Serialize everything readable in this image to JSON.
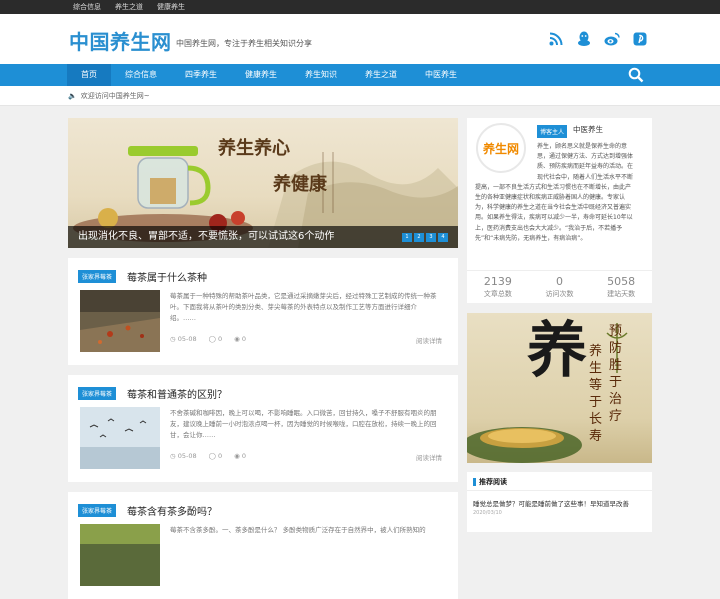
{
  "topbar": {
    "links": [
      "综合信息",
      "养生之道",
      "健康养生"
    ]
  },
  "header": {
    "logo": "中国养生网",
    "slogan": "中国养生网，专注于养生相关知识分享"
  },
  "social_icons": [
    "rss-icon",
    "qq-icon",
    "weibo-icon",
    "pinterest-icon"
  ],
  "nav": {
    "items": [
      "首页",
      "综合信息",
      "四季养生",
      "健康养生",
      "养生知识",
      "养生之道",
      "中医养生"
    ]
  },
  "notice": "欢迎访问中国养生网~",
  "slider": {
    "caption": "出现消化不良、胃部不适，不要慌张，可以试试这6个动作",
    "calligraphy_top": "养生养心",
    "calligraphy_bottom": "养健康",
    "dots": [
      "1",
      "2",
      "3",
      "4"
    ]
  },
  "posts": [
    {
      "tag": "张家界莓茶",
      "title": "莓茶属于什么茶种",
      "excerpt": "莓茶属于一种特殊的帮助茶叶品类，它是通过采摘嫩芽尖后，经过特殊工艺制成的传统一种茶叶。下面我将从茶叶的类别分类、芽尖莓茶的外表特点以及制作工艺等方面进行详细介绍。……",
      "date": "05-08",
      "comments": "0",
      "likes": "0",
      "more": "阅读详情"
    },
    {
      "tag": "张家界莓茶",
      "title": "莓茶和普通茶的区别？",
      "excerpt": "不舍茶碱和咖啡因，晚上可以喝，不影响睡眠。入口微苦，回甘持久，嗓子不舒服有咽炎的朋友，建议晚上睡前一小时泡浓点喝一杯，因为睡觉的时候喉咙，口腔在放松，持续一晚上的回甘，会让你……",
      "date": "05-08",
      "comments": "0",
      "likes": "0",
      "more": "阅读详情"
    },
    {
      "tag": "张家界莓茶",
      "title": "莓茶含有茶多酚吗？",
      "excerpt": "莓茶不含茶多酚。一、茶多酚是什么？ 多酚类物质广泛存在于自然界中，被人们所熟知的",
      "date": "",
      "comments": "",
      "likes": "",
      "more": ""
    }
  ],
  "profile": {
    "avatar_text": "养生网",
    "role": "博客主人",
    "name": "中医养生",
    "bio_lines": [
      "养生，顾名思义就是保养生命的意",
      "思，通过保健方法、方式达到增强体",
      "质、预防疾病而延年益寿的活动。在",
      "现代社会中，随着人们生活水平不断",
      "提高，一部不良生活方式和生活习惯也在不断增长，由此产",
      "生的各种亚健康症状和疾病正威胁着国人的健康。专家认",
      "为，科学健康的养生之道在当今社会生活中既经济又普遍实",
      "用。如果养生得法，疾病可以减少一半，寿命可延长10年以",
      "上，医药消费支出也会大大减少。“我治于后，不若播予",
      "先”和“未病先防，无病养生，有病治病”。"
    ],
    "stats": [
      {
        "num": "2139",
        "label": "文章总数"
      },
      {
        "num": "0",
        "label": "访问次数"
      },
      {
        "num": "5058",
        "label": "建站天数"
      }
    ]
  },
  "ad": {
    "big_char": "养",
    "col1": "预防胜于治疗",
    "col2": "养生等于长寿"
  },
  "recommend": {
    "heading": "推荐阅读",
    "item": "睡觉总是做梦？可能是睡前做了这些事！早知道早改善",
    "date": "2020/03/10"
  },
  "colors": {
    "brand": "#1e8fd6",
    "nav_active": "#167ac0",
    "logo": "#2a8fd0"
  }
}
